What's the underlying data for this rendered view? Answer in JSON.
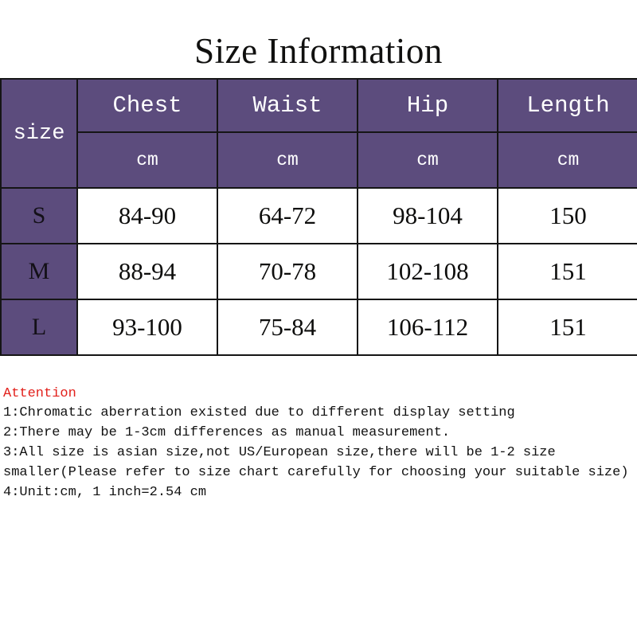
{
  "title": "Size Information",
  "colors": {
    "header_purple": "#5c4c7d",
    "attention_red": "#e2211c",
    "text_black": "#121212",
    "cell_white": "#ffffff",
    "border": "#151515"
  },
  "table": {
    "size_header": "size",
    "measurement_headers": [
      "Chest",
      "Waist",
      "Hip",
      "Length"
    ],
    "unit_headers": [
      "cm",
      "cm",
      "cm",
      "cm"
    ],
    "rows": [
      {
        "size": "S",
        "values": [
          "84-90",
          "64-72",
          "98-104",
          "150"
        ]
      },
      {
        "size": "M",
        "values": [
          "88-94",
          "70-78",
          "102-108",
          "151"
        ]
      },
      {
        "size": "L",
        "values": [
          "93-100",
          "75-84",
          "106-112",
          "151"
        ]
      }
    ]
  },
  "notes": {
    "heading": "Attention",
    "items": [
      "1:Chromatic aberration existed due to different display setting",
      "2:There may be 1-3cm differences as manual measurement.",
      "3:All size is asian size,not US/European size,there will be 1-2 size smaller(Please refer to size chart carefully for choosing your suitable size)",
      "4:Unit:cm, 1 inch=2.54 cm"
    ]
  },
  "chart_data": {
    "type": "table",
    "title": "Size Information",
    "columns": [
      "size",
      "Chest (cm)",
      "Waist (cm)",
      "Hip (cm)",
      "Length (cm)"
    ],
    "rows": [
      [
        "S",
        "84-90",
        "64-72",
        "98-104",
        "150"
      ],
      [
        "M",
        "88-94",
        "70-78",
        "102-108",
        "151"
      ],
      [
        "L",
        "93-100",
        "75-84",
        "106-112",
        "151"
      ]
    ]
  }
}
